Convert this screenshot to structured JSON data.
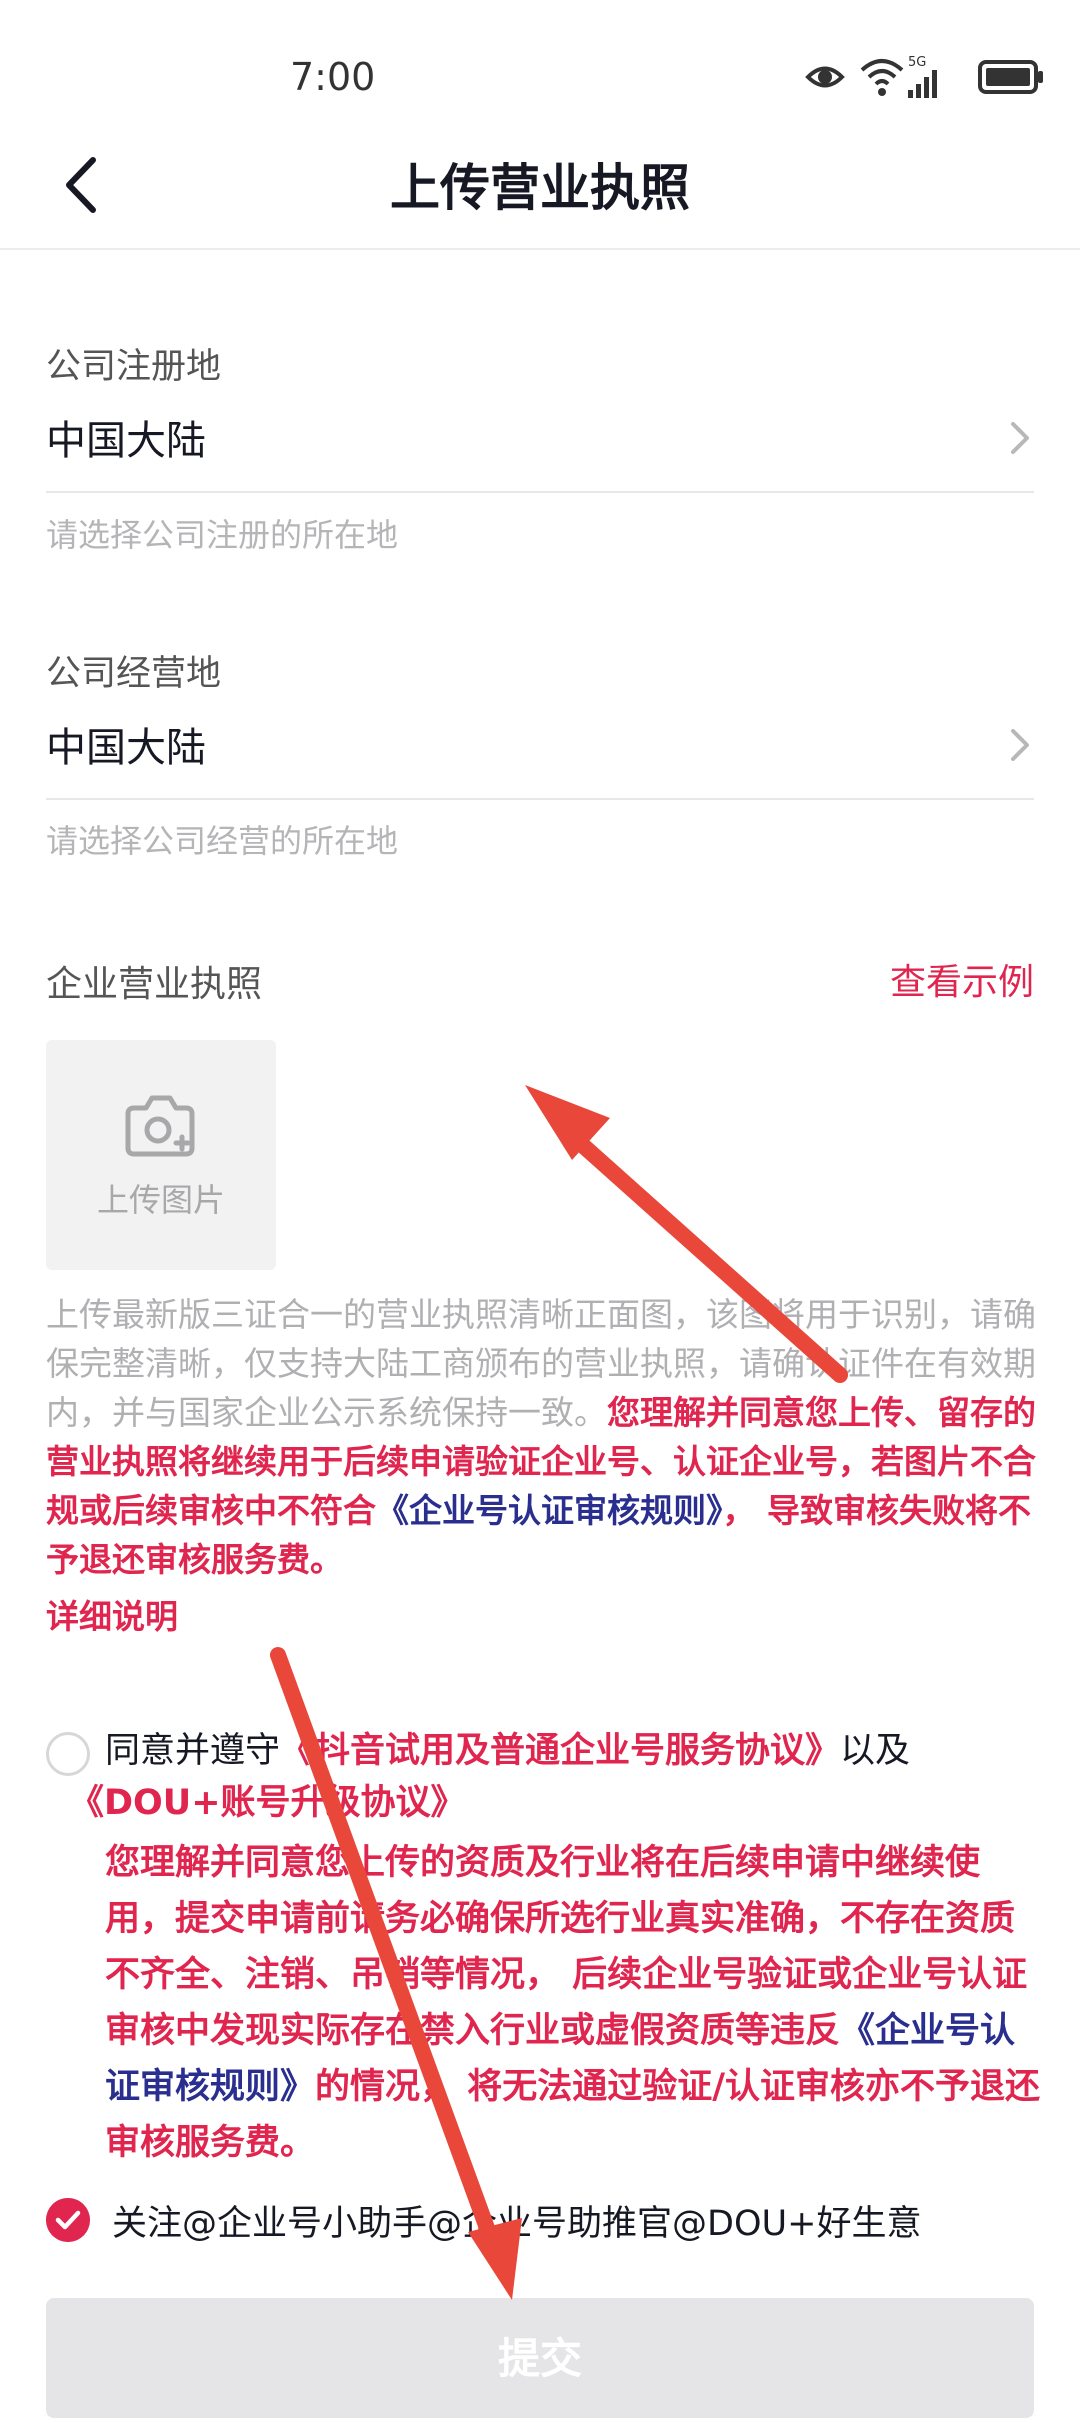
{
  "status_bar": {
    "time": "7:00",
    "network": "5G"
  },
  "header": {
    "title": "上传营业执照"
  },
  "registration": {
    "label": "公司注册地",
    "value": "中国大陆",
    "hint": "请选择公司注册的所在地"
  },
  "operation": {
    "label": "公司经营地",
    "value": "中国大陆",
    "hint": "请选择公司经营的所在地"
  },
  "license": {
    "section_title": "企业营业执照",
    "example_link": "查看示例",
    "upload_label": "上传图片",
    "desc_grey": "上传最新版三证合一的营业执照清晰正面图，该图将用于识别，请确保完整清晰，仅支持大陆工商颁布的营业执照，请确认证件在有效期内，并与国家企业公示系统保持一致。",
    "desc_red": "您理解并同意您上传、留存的营业执照将继续用于后续申请验证企业号、认证企业号，若图片不合规或后续审核中不符合",
    "desc_rules": "《企业号认证审核规则》",
    "desc_tail": "， 导致审核失败将不予退还审核服务费。",
    "detail_link": "详细说明"
  },
  "agreement": {
    "prefix": "同意并遵守",
    "link1": "《抖音试用及普通企业号服务协议》",
    "middle": "以及",
    "link2": "《DOU+账号升级协议》",
    "body1": "您理解并同意您上传的资质及行业将在后续申请中继续使用，提交申请前请务必确保所选行业真实准确，不存在资质不齐全、注销、吊销等情况， 后续企业号验证或企业号认证审核中发现实际存在禁入行业或虚假资质等违反",
    "body_rules": "《企业号认证审核规则》",
    "body2": "的情况， 将无法通过验证/认证审核亦不予退还审核服务费。",
    "checked": false
  },
  "follow": {
    "label": "关注@企业号小助手@企业号助推官@DOU+好生意",
    "checked": true
  },
  "submit": {
    "label": "提交",
    "enabled": false
  },
  "colors": {
    "accent": "#e0264f",
    "link_blue": "#2a2f8f",
    "annotation_arrow": "#e8473a"
  }
}
